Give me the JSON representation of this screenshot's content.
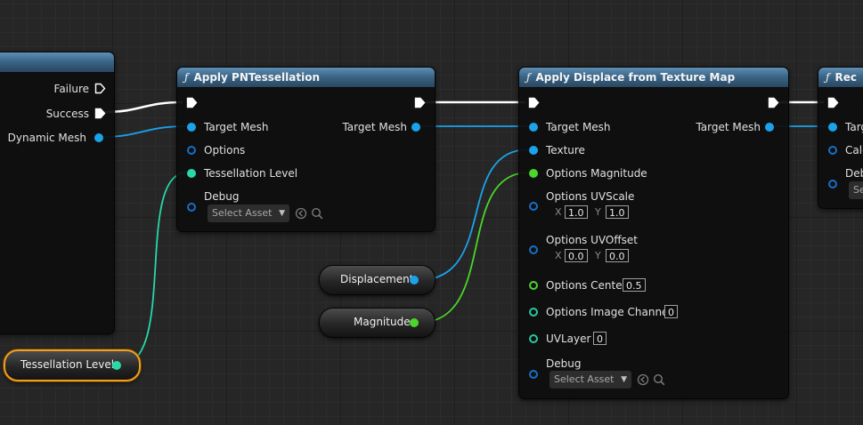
{
  "nodes": {
    "left_node": {
      "pins": {
        "failure": "Failure",
        "success": "Success",
        "dynamic_mesh": "Dynamic Mesh"
      }
    },
    "pn_tessellation": {
      "title": "Apply PNTessellation",
      "inputs": {
        "target_mesh": "Target Mesh",
        "options": "Options",
        "tessellation_level": "Tessellation Level",
        "debug": "Debug"
      },
      "outputs": {
        "target_mesh": "Target Mesh"
      },
      "debug_asset": "Select Asset"
    },
    "displace_texture": {
      "title": "Apply Displace from Texture Map",
      "inputs": {
        "target_mesh": "Target Mesh",
        "texture": "Texture",
        "options_magnitude": "Options Magnitude",
        "options_uvscale": "Options UVScale",
        "options_uvoffset": "Options UVOffset",
        "options_center": "Options Center",
        "options_image_channel": "Options Image Channel",
        "uvlayer": "UVLayer",
        "debug": "Debug"
      },
      "outputs": {
        "target_mesh": "Target Mesh"
      },
      "uvscale": {
        "x_label": "X",
        "x": "1.0",
        "y_label": "Y",
        "y": "1.0"
      },
      "uvoffset": {
        "x_label": "X",
        "x": "0.0",
        "y_label": "Y",
        "y": "0.0"
      },
      "center": "0.5",
      "image_channel": "0",
      "uvlayer_value": "0",
      "debug_asset": "Select Asset"
    },
    "recompute_partial": {
      "title": "Rec",
      "inputs": {
        "target_mesh": "Targ",
        "calc": "Calc",
        "debug": "Deb"
      },
      "debug_asset": "Se"
    }
  },
  "variables": {
    "displacement": "Displacement",
    "magnitude": "Magnitude",
    "tessellation_level": "Tessellation Level"
  },
  "icons": {
    "function": "ƒ",
    "dropdown": "chevron-down",
    "browse": "arrow-left-circle",
    "find": "search"
  },
  "colors": {
    "exec_wire": "#ffffff",
    "mesh_wire": "#1ba3ea",
    "float_wire": "#28d8a8",
    "magnitude_wire": "#4ad62a",
    "selected_outline": "#f0a020"
  }
}
